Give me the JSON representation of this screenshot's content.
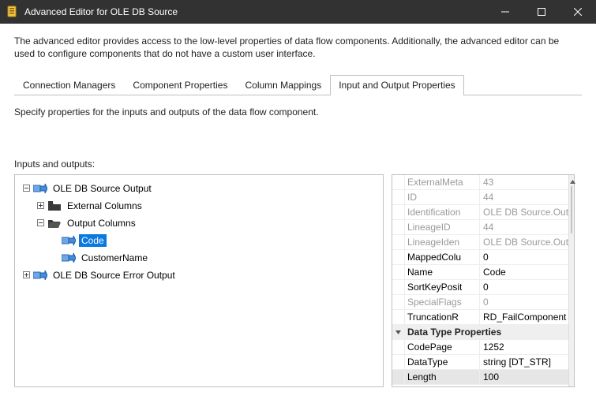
{
  "window": {
    "title": "Advanced Editor for OLE DB Source"
  },
  "description": "The advanced editor provides access to the low-level properties of data flow components. Additionally, the advanced editor can be used to configure components that do not have a custom user interface.",
  "tabs": {
    "connection": "Connection Managers",
    "component": "Component Properties",
    "columns": "Column Mappings",
    "io": "Input and Output Properties"
  },
  "io_tab": {
    "instruction": "Specify properties for the inputs and outputs of the data flow component.",
    "tree_label": "Inputs and outputs:",
    "tree": {
      "source_output": "OLE DB Source Output",
      "external_columns": "External Columns",
      "output_columns": "Output Columns",
      "col_code": "Code",
      "col_customer": "CustomerName",
      "error_output": "OLE DB Source Error Output"
    }
  },
  "properties": {
    "rows": [
      {
        "key": "ExternalMeta",
        "value": "43",
        "disabled": true
      },
      {
        "key": "ID",
        "value": "44",
        "disabled": true
      },
      {
        "key": "Identification",
        "value": "OLE DB Source.Out",
        "disabled": true
      },
      {
        "key": "LineageID",
        "value": "44",
        "disabled": true
      },
      {
        "key": "LineageIden",
        "value": "OLE DB Source.Out",
        "disabled": true
      },
      {
        "key": "MappedColu",
        "value": "0"
      },
      {
        "key": "Name",
        "value": "Code"
      },
      {
        "key": "SortKeyPosit",
        "value": "0"
      },
      {
        "key": "SpecialFlags",
        "value": "0",
        "disabled": true
      },
      {
        "key": "TruncationR",
        "value": "RD_FailComponent"
      }
    ],
    "category": "Data Type Properties",
    "dtp": [
      {
        "key": "CodePage",
        "value": "1252"
      },
      {
        "key": "DataType",
        "value": "string [DT_STR]"
      },
      {
        "key": "Length",
        "value": "100",
        "highlight": true
      }
    ]
  }
}
